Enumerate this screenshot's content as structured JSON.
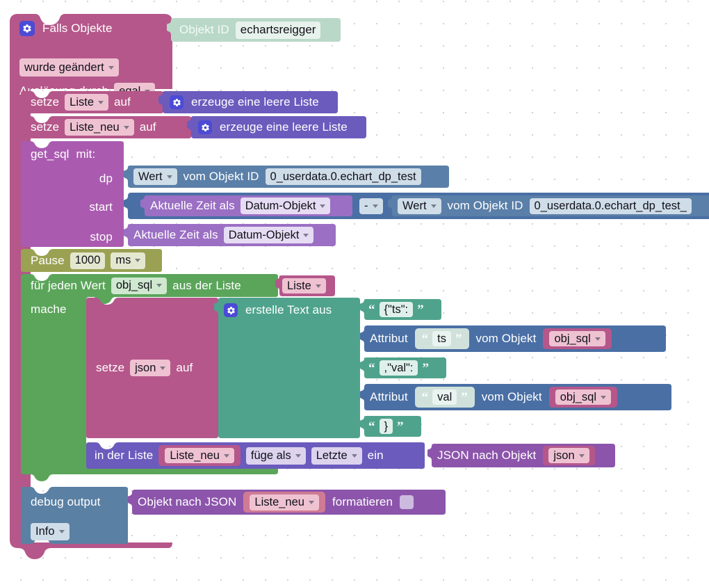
{
  "workspace": {
    "kind": "blockly-workspace",
    "language": "de",
    "grid": "dot-grid"
  },
  "colors": {
    "event_pink": "#b5578a",
    "event_pink_body": "#b25685",
    "objectid_green": "#b9d8c8",
    "variable_purple": "#6b5bbd",
    "function_purple": "#aa5bb0",
    "datapoint_blue": "#5a7fa8",
    "timing_olive": "#9aa152",
    "loop_green": "#5ba55b",
    "text_teal": "#4fa38c",
    "attribute_blue": "#4a6fa5",
    "date_purple": "#9b6fc4",
    "json_purple": "#8c55ab",
    "debug_blue": "#5a80a3",
    "field_white": "#ffffff",
    "field_pink": "#efc2d2",
    "field_lavender": "#ddd3ef"
  },
  "event_block": {
    "icon": "gear-icon",
    "title": "Falls Objekte",
    "trigger_field": "wurde geändert",
    "cause_label": "Auslösung durch",
    "cause_field": "egal",
    "object_id": {
      "label": "Objekt ID",
      "value": "echartsreigger"
    }
  },
  "statements": {
    "set_liste": {
      "set_label": "setze",
      "variable": "Liste",
      "to_label": "auf",
      "value": {
        "icon": "gear-icon",
        "text": "erzeuge eine leere Liste"
      }
    },
    "set_liste_neu": {
      "set_label": "setze",
      "variable": "Liste_neu",
      "to_label": "auf",
      "value": {
        "icon": "gear-icon",
        "text": "erzeuge eine leere Liste"
      }
    },
    "get_sql": {
      "name": "get_sql",
      "with_label": "mit:",
      "args": [
        {
          "name": "dp",
          "value": {
            "type": "datapoint",
            "mode": "Wert",
            "label": "vom Objekt ID",
            "object_id": "0_userdata.0.echart_dp_test"
          }
        },
        {
          "name": "start",
          "value": {
            "type": "arithmetic",
            "left": {
              "label": "Aktuelle Zeit als",
              "field": "Datum-Objekt"
            },
            "operator": "-",
            "right": {
              "type": "datapoint",
              "mode": "Wert",
              "label": "vom Objekt ID",
              "object_id": "0_userdata.0.echart_dp_test_"
            }
          }
        },
        {
          "name": "stop",
          "value": {
            "label": "Aktuelle Zeit als",
            "field": "Datum-Objekt"
          }
        }
      ]
    },
    "pause": {
      "label": "Pause",
      "amount": "1000",
      "unit": "ms"
    },
    "foreach": {
      "label": "für jeden Wert",
      "item_var": "obj_sql",
      "from_label": "aus der Liste",
      "list_var": "Liste",
      "do_label": "mache"
    },
    "set_json": {
      "set_label": "setze",
      "variable": "json",
      "to_label": "auf"
    },
    "create_text": {
      "icon": "gear-icon",
      "label": "erstelle Text aus",
      "parts": [
        {
          "type": "text",
          "value": "{\"ts\":"
        },
        {
          "type": "attribute",
          "label": "Attribut",
          "attr": "ts",
          "of_label": "vom Objekt",
          "object": "obj_sql"
        },
        {
          "type": "text",
          "value": ",\"val\":"
        },
        {
          "type": "attribute",
          "label": "Attribut",
          "attr": "val",
          "of_label": "vom Objekt",
          "object": "obj_sql"
        },
        {
          "type": "text",
          "value": "}"
        }
      ]
    },
    "list_insert": {
      "in_list_label": "in der Liste",
      "list_var": "Liste_neu",
      "add_label": "füge als",
      "position": "Letzte",
      "insert_label": "ein",
      "value": {
        "label": "JSON nach Objekt",
        "variable": "json"
      }
    },
    "debug": {
      "label": "debug output",
      "level": "Info",
      "value": {
        "label": "Objekt nach JSON",
        "variable": "Liste_neu",
        "format_label": "formatieren",
        "format_checked": false
      }
    }
  }
}
